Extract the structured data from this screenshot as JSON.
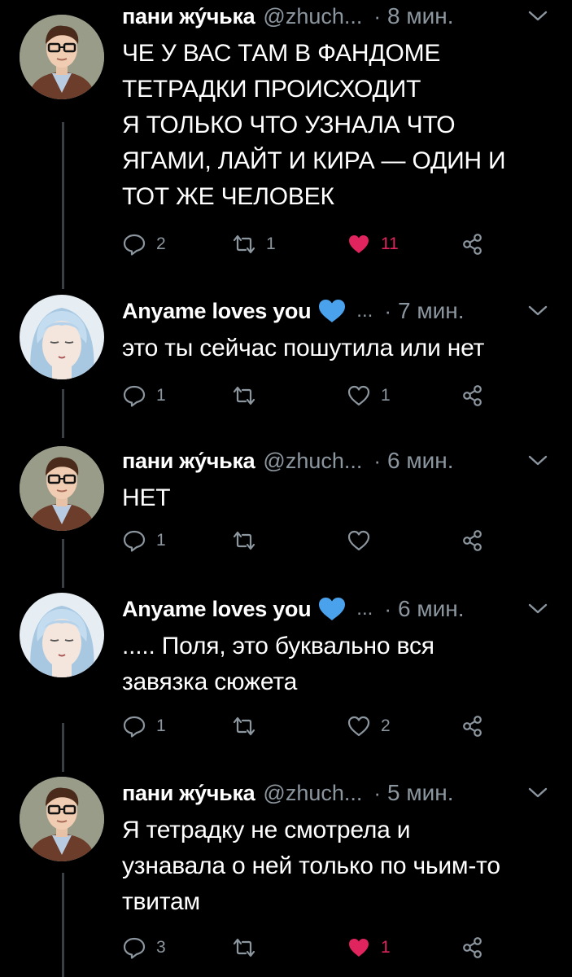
{
  "colors": {
    "background": "#000000",
    "text": "#ffffff",
    "muted": "#8c969f",
    "like": "#e0245e",
    "verified_heart": "#4aa1ec",
    "thread_line": "#3a3f44"
  },
  "tweets": [
    {
      "name": "пани жу́чька",
      "handle": "@zhuch...",
      "time": "8 мин.",
      "text": [
        "ЧЕ У ВАС ТАМ В ФАНДОМЕ",
        "ТЕТРАДКИ ПРОИСХОДИТ",
        "Я ТОЛЬКО ЧТО УЗНАЛА ЧТО",
        "ЯГАМИ, ЛАЙТ И КИРА — ОДИН И",
        "ТОТ ЖЕ ЧЕЛОВЕК"
      ],
      "replies": "2",
      "retweets": "1",
      "likes": "11",
      "liked": true,
      "avatar_icon": "man-glasses-avatar"
    },
    {
      "name": "Anyame loves you",
      "badge_icon": "blue-heart-icon",
      "ellipsis": "...",
      "time": "7 мин.",
      "text": [
        "это ты сейчас пошутила или нет"
      ],
      "replies": "1",
      "retweets": "",
      "likes": "1",
      "liked": false,
      "avatar_icon": "anime-face-avatar"
    },
    {
      "name": "пани жу́чька",
      "handle": "@zhuch...",
      "time": "6 мин.",
      "text": [
        "НЕТ"
      ],
      "replies": "1",
      "retweets": "",
      "likes": "",
      "liked": false,
      "avatar_icon": "man-glasses-avatar"
    },
    {
      "name": "Anyame loves you",
      "badge_icon": "blue-heart-icon",
      "ellipsis": "...",
      "time": "6 мин.",
      "text": [
        ".....  Поля, это буквально вся",
        "завязка сюжета"
      ],
      "replies": "1",
      "retweets": "",
      "likes": "2",
      "liked": false,
      "avatar_icon": "anime-face-avatar"
    },
    {
      "name": "пани жу́чька",
      "handle": "@zhuch...",
      "time": "5 мин.",
      "text": [
        "Я тетрадку не смотрела и",
        "узнавала о ней только по чьим-то",
        "твитам"
      ],
      "replies": "3",
      "retweets": "",
      "likes": "1",
      "liked": true,
      "avatar_icon": "man-glasses-avatar"
    }
  ]
}
